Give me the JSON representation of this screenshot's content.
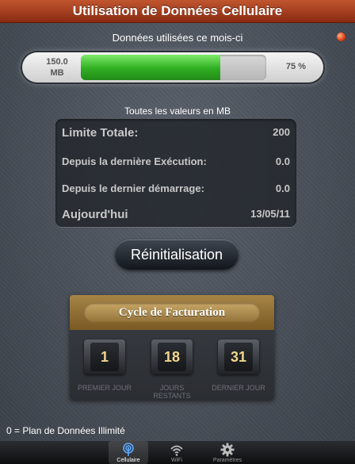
{
  "header": {
    "title": "Utilisation de Données Cellulaire"
  },
  "usage": {
    "label": "Données utilisées ce mois-ci",
    "used_value": "150.0",
    "used_unit": "MB",
    "percent_text": "75 %",
    "percent": 75
  },
  "values_caption": "Toutes les valeurs en MB",
  "stats": [
    {
      "label": "Limite Totale:",
      "value": "200"
    },
    {
      "label": "Depuis la dernière Exécution:",
      "value": "0.0"
    },
    {
      "label": "Depuis le dernier démarrage:",
      "value": "0.0"
    },
    {
      "label": "Aujourd'hui",
      "value": "13/05/11"
    }
  ],
  "reset_button": "Réinitialisation",
  "billing": {
    "title": "Cycle de Facturation",
    "dials": [
      {
        "value": "1",
        "caption": "PREMIER JOUR"
      },
      {
        "value": "18",
        "caption": "JOURS RESTANTS"
      },
      {
        "value": "31",
        "caption": "DERNIER JOUR"
      }
    ]
  },
  "footer_note": "0 = Plan de Données Illimité",
  "tabs": [
    {
      "label": "Cellulaire",
      "icon": "antenna-icon",
      "selected": true
    },
    {
      "label": "WiFi",
      "icon": "wifi-icon",
      "selected": false
    },
    {
      "label": "Paramètres",
      "icon": "gear-icon",
      "selected": false
    }
  ],
  "colors": {
    "title_bar": "#a53b1c",
    "usage_fill": "#3cc02a",
    "dial_digits": "#f1d68c"
  }
}
